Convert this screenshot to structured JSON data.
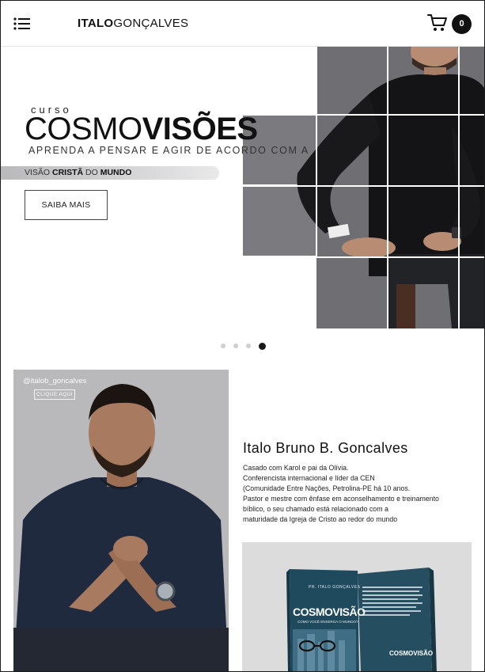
{
  "header": {
    "logo_bold": "ITALO",
    "logo_light": "GONÇALVES",
    "cart_count": "0"
  },
  "hero": {
    "curso": "curso",
    "title_thin": "COSMO",
    "title_bold": "VISÕES",
    "tagline": "APRENDA A PENSAR E AGIR DE ACORDO COM A",
    "visao_1": "VISÃO ",
    "visao_2": "CRISTÃ",
    "visao_3": " DO ",
    "visao_4": "MUNDO",
    "cta_label": "SAIBA MAIS",
    "slides_total": 4,
    "active_slide": 4
  },
  "instagram": {
    "handle": "@italob_goncalves",
    "button_label": "CLIQUE AQUI"
  },
  "bio": {
    "name": "Italo Bruno B. Goncalves",
    "lines": [
      "Casado com Karol e pai da Olívia.",
      "Conferencista internacional e líder da CEN",
      "(Comunidade Entre Nações, Petrolina-PE há 10 anos.",
      "Pastor e mestre com ênfase em aconselhamento e treinamento",
      "bíblico, o seu chamado está relacionado com a",
      "maturidade da Igreja de Cristo ao redor do mundo"
    ]
  },
  "books": {
    "author": "PR. ITALO GONÇALVES",
    "title": "COSMOVISÃO",
    "subtitle": "COMO VOCÊ ENXERGA O MUNDO?",
    "back_title": "COSMOVISÃO"
  },
  "colors": {
    "accent": "#111111",
    "tile_gray": "#7b7b7f",
    "book_blue": "#1f4a5e"
  },
  "icons": [
    "menu-icon",
    "cart-icon"
  ]
}
